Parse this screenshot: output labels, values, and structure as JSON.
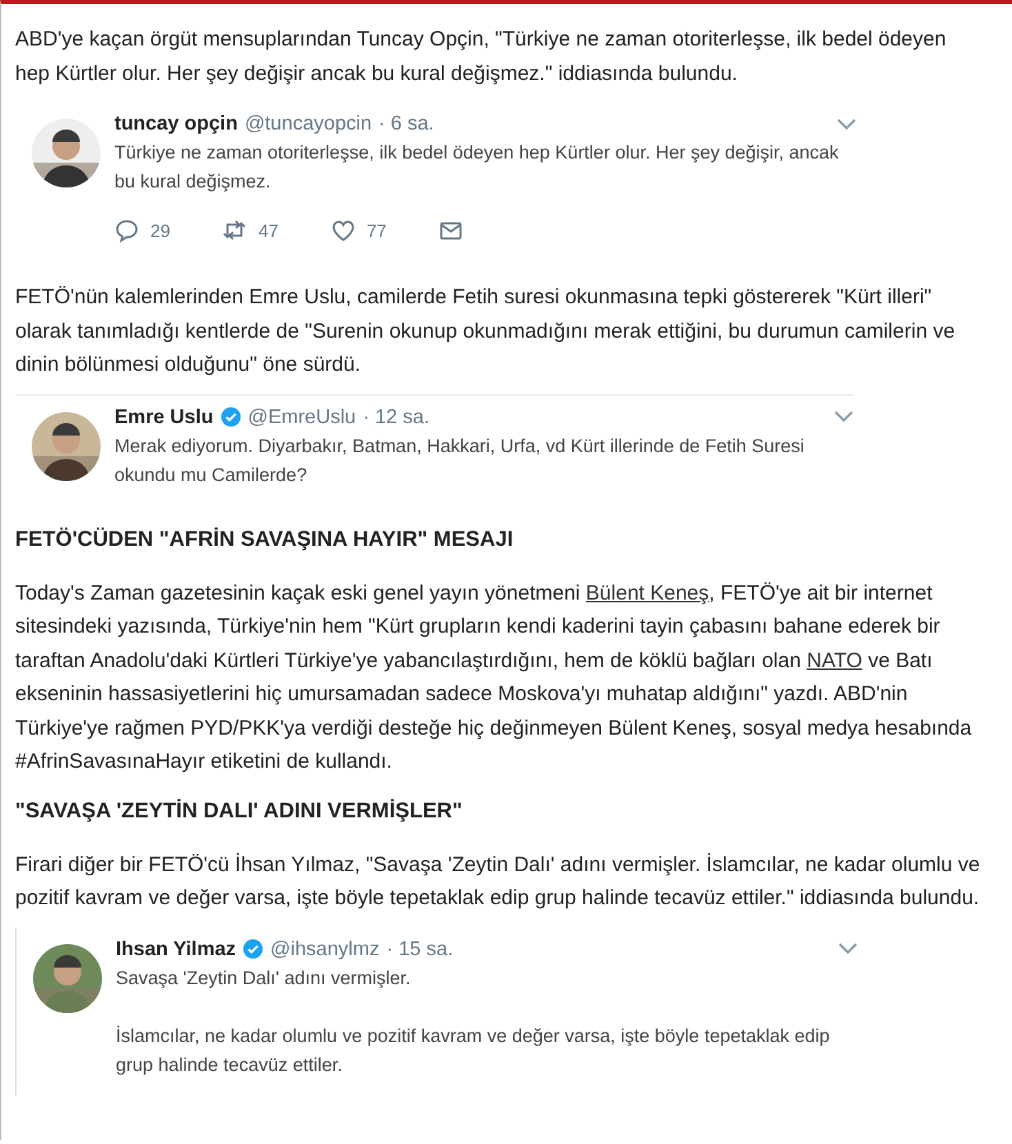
{
  "blocks": [
    {
      "kind": "paragraph",
      "segments": [
        {
          "kind": "text",
          "text": "ABD'ye kaçan örgüt mensuplarından Tuncay Opçin, \"Türkiye ne zaman otoriterleşse, ilk bedel ödeyen hep Kürtler olur. Her şey değişir ancak bu kural değişmez.\" iddiasında bulundu."
        }
      ]
    },
    {
      "kind": "tweet",
      "name": "tuncay opçin",
      "verified": false,
      "handle": "@tuncayopcin",
      "time": "· 6 sa.",
      "top_rule": false,
      "side_rule": false,
      "text": [
        "Türkiye ne zaman otoriterleşse, ilk bedel ödeyen hep Kürtler olur. Her şey değişir, ancak bu kural değişmez."
      ],
      "actions": [
        {
          "kind": "reply",
          "count": "29"
        },
        {
          "kind": "retweet",
          "count": "47"
        },
        {
          "kind": "like",
          "count": "77"
        },
        {
          "kind": "message"
        }
      ]
    },
    {
      "kind": "paragraph",
      "segments": [
        {
          "kind": "text",
          "text": "FETÖ'nün kalemlerinden Emre Uslu, camilerde Fetih suresi okunmasına tepki göstererek \"Kürt illeri\" olarak tanımladığı kentlerde de \"Surenin okunup okunmadığını merak ettiğini, bu durumun camilerin ve dinin bölünmesi olduğunu\" öne sürdü."
        }
      ]
    },
    {
      "kind": "tweet",
      "name": "Emre Uslu",
      "verified": true,
      "handle": "@EmreUslu",
      "time": "· 12 sa.",
      "top_rule": true,
      "side_rule": false,
      "text": [
        "Merak ediyorum. Diyarbakır, Batman, Hakkari, Urfa, vd Kürt illerinde de Fetih Suresi okundu mu Camilerde?"
      ]
    },
    {
      "kind": "heading",
      "text": "FETÖ'CÜDEN \"AFRİN SAVAŞINA HAYIR\" MESAJI"
    },
    {
      "kind": "paragraph",
      "segments": [
        {
          "kind": "text",
          "text": "Today's Zaman gazetesinin kaçak eski genel yayın yönetmeni "
        },
        {
          "kind": "link",
          "text": "Bülent Keneş"
        },
        {
          "kind": "text",
          "text": ", FETÖ'ye ait bir internet sitesindeki yazısında, Türkiye'nin hem \"Kürt grupların kendi kaderini tayin çabasını bahane ederek bir taraftan Anadolu'daki Kürtleri Türkiye'ye yabancılaştırdığını, hem de köklü bağları olan "
        },
        {
          "kind": "link",
          "text": "NATO"
        },
        {
          "kind": "text",
          "text": " ve Batı ekseninin hassasiyetlerini hiç umursamadan sadece Moskova'yı muhatap aldığını\" yazdı. ABD'nin Türkiye'ye rağmen PYD/PKK'ya verdiği desteğe hiç değinmeyen Bülent Keneş, sosyal medya hesabında #AfrinSavasınaHayır etiketini de kullandı."
        }
      ]
    },
    {
      "kind": "heading",
      "text": "\"SAVAŞA 'ZEYTİN DALI' ADINI VERMİŞLER\""
    },
    {
      "kind": "paragraph",
      "segments": [
        {
          "kind": "text",
          "text": "Firari diğer bir FETÖ'cü İhsan Yılmaz, \"Savaşa 'Zeytin Dalı' adını vermişler. İslamcılar, ne kadar olumlu ve pozitif kavram ve değer varsa, işte böyle tepetaklak edip grup halinde tecavüz ettiler.\" iddiasında bulundu."
        }
      ]
    },
    {
      "kind": "tweet",
      "name": "Ihsan Yilmaz",
      "verified": true,
      "handle": "@ihsanylmz",
      "time": "· 15 sa.",
      "top_rule": false,
      "side_rule": true,
      "text": [
        "Savaşa 'Zeytin Dalı' adını vermişler.",
        "İslamcılar, ne kadar olumlu ve pozitif kavram ve değer varsa, işte böyle tepetaklak edip grup halinde tecavüz ettiler."
      ]
    }
  ]
}
